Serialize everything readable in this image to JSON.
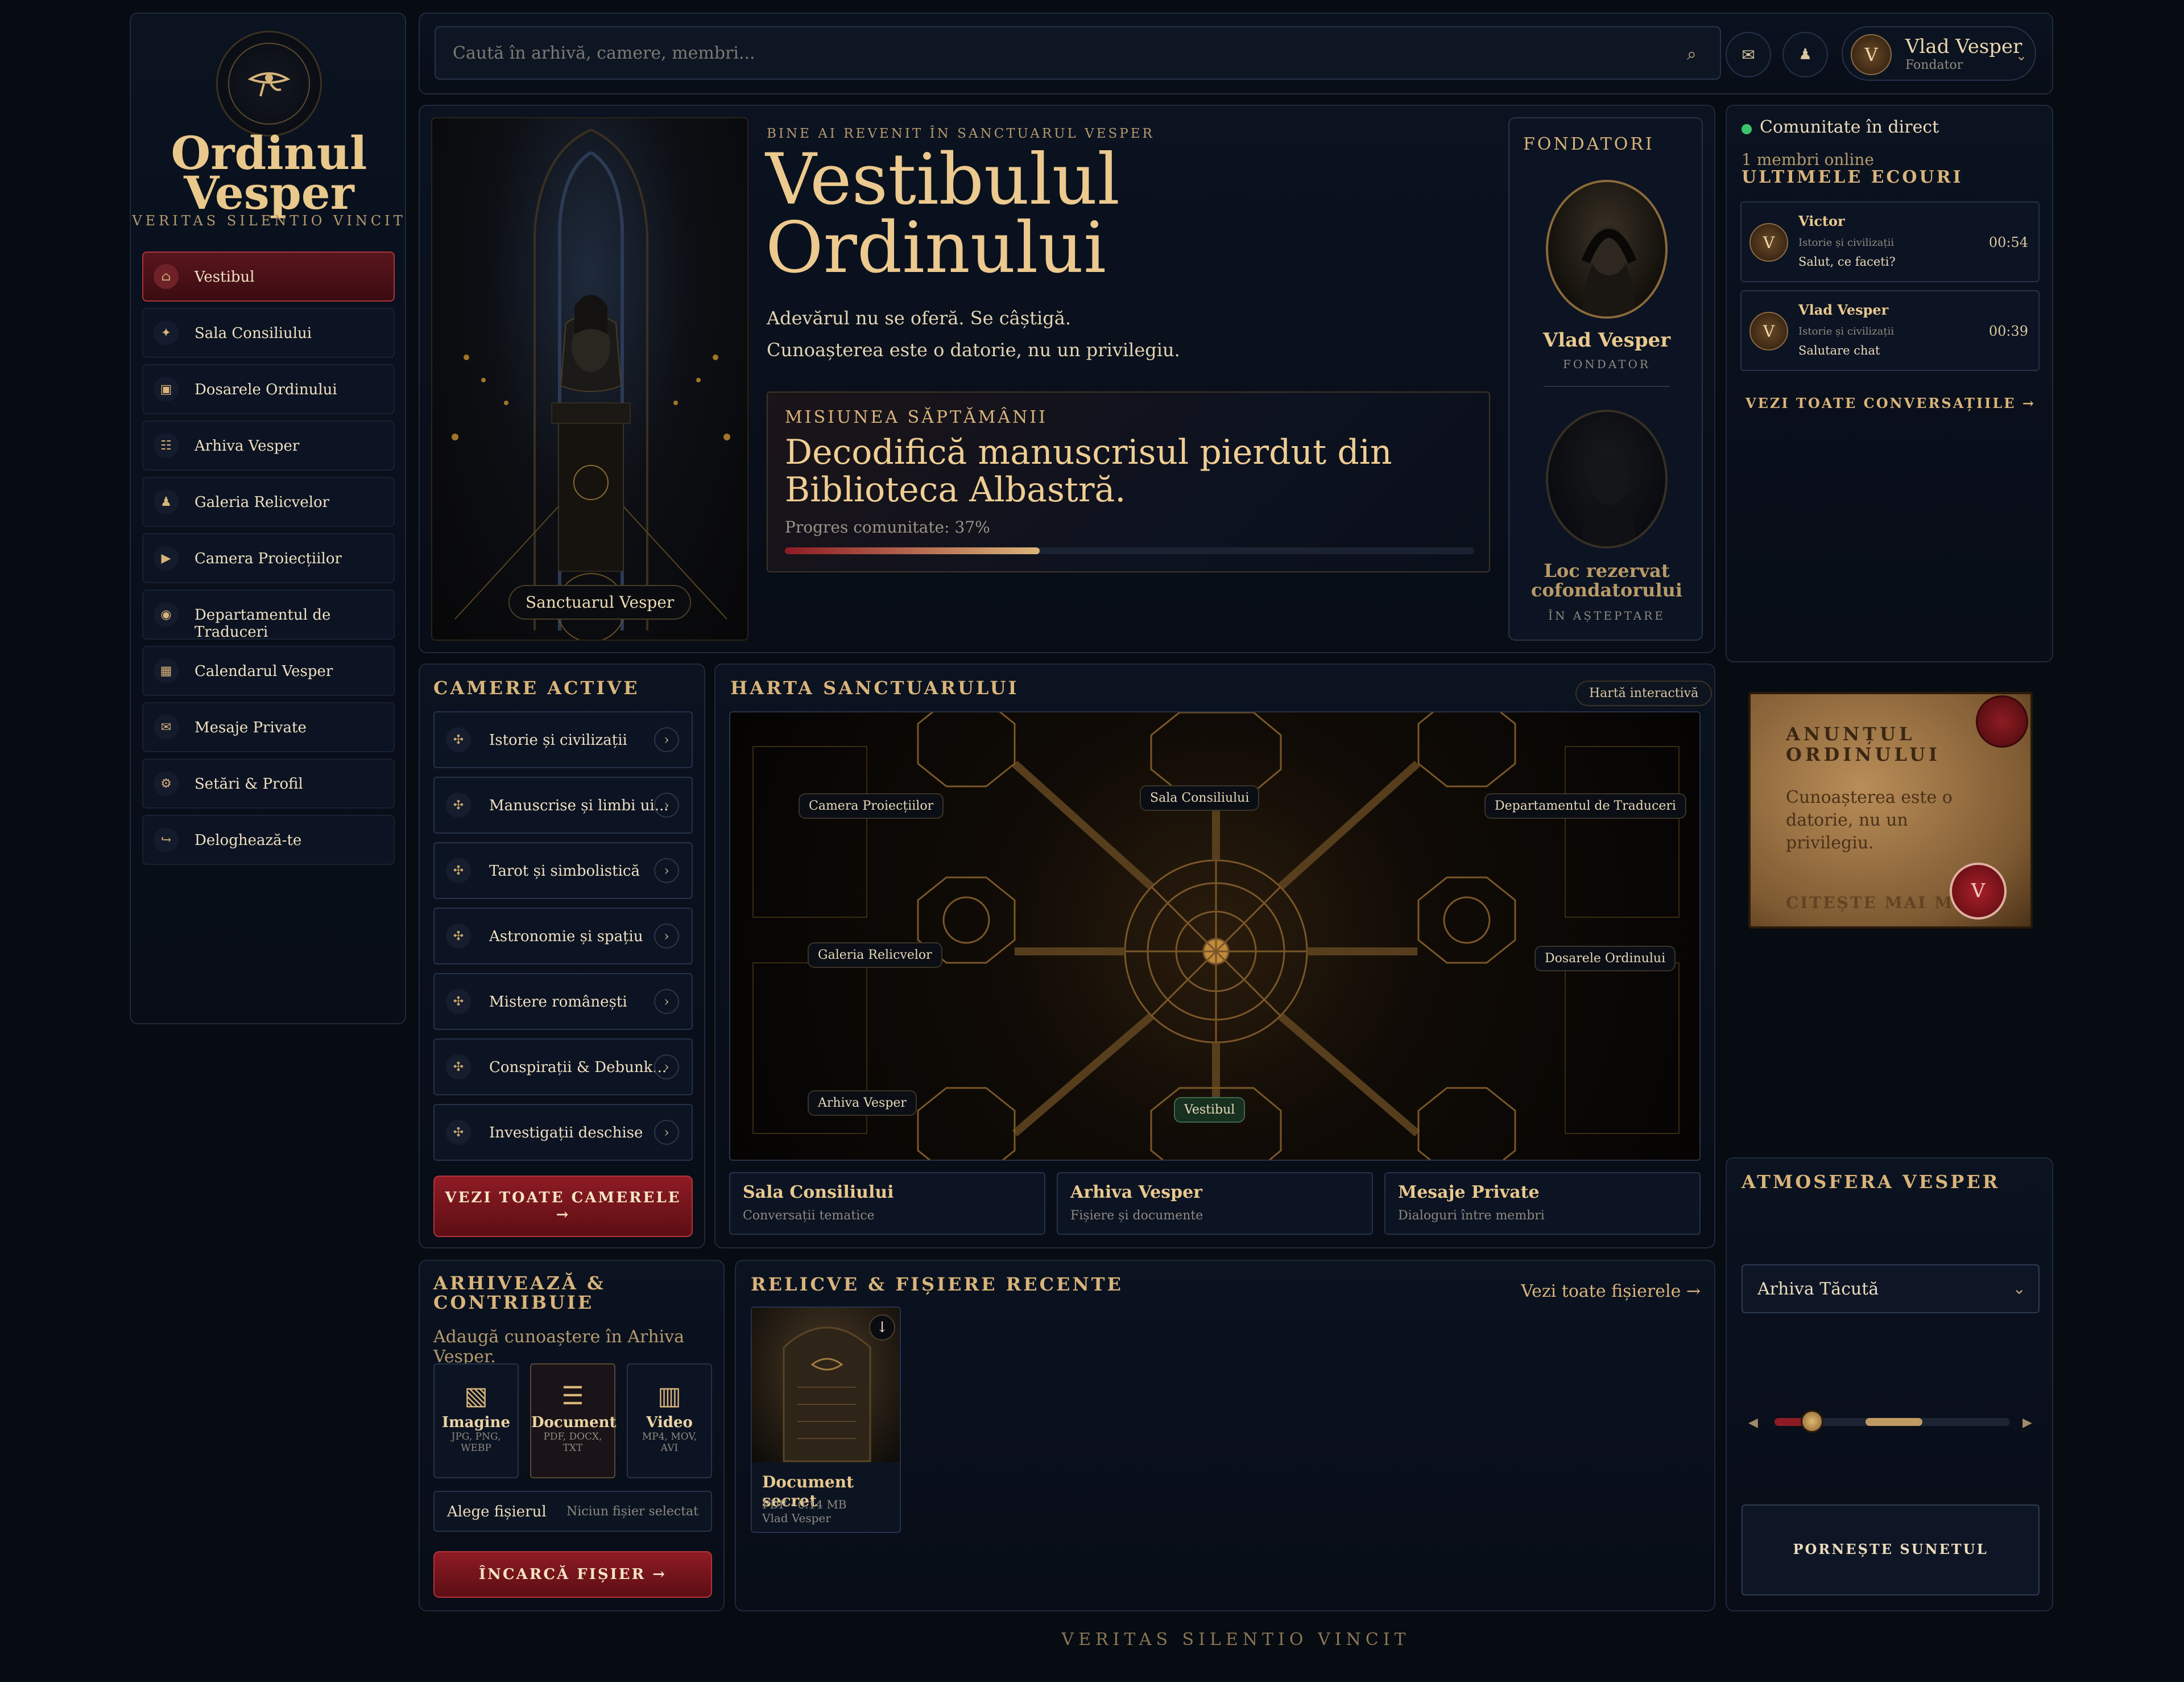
{
  "brand": {
    "name_line1": "Ordinul",
    "name_line2": "Vesper",
    "motto": "VERITAS SILENTIO VINCIT",
    "logo_icon": "eye-of-horus-icon"
  },
  "sidebar": {
    "items": [
      {
        "label": "Vestibul",
        "icon": "home-icon",
        "active": true
      },
      {
        "label": "Sala Consiliului",
        "icon": "compass-icon"
      },
      {
        "label": "Dosarele Ordinului",
        "icon": "folder-icon"
      },
      {
        "label": "Arhiva Vesper",
        "icon": "list-icon"
      },
      {
        "label": "Galeria Relicvelor",
        "icon": "figure-icon"
      },
      {
        "label": "Camera Proiecțiilor",
        "icon": "play-icon"
      },
      {
        "label": "Departamentul de Traduceri",
        "icon": "target-icon"
      },
      {
        "label": "Calendarul Vesper",
        "icon": "calendar-icon"
      },
      {
        "label": "Mesaje Private",
        "icon": "mail-icon"
      },
      {
        "label": "Setări & Profil",
        "icon": "gear-icon"
      },
      {
        "label": "Deloghează-te",
        "icon": "logout-icon"
      }
    ]
  },
  "header": {
    "search_placeholder": "Caută în arhivă, camere, membri...",
    "user_name": "Vlad Vesper",
    "user_role": "Fondator",
    "avatar_letter": "V"
  },
  "hero": {
    "eyebrow": "BINE AI REVENIT ÎN SANCTUARUL VESPER",
    "title_line1": "Vestibulul",
    "title_line2": "Ordinului",
    "line1": "Adevărul nu se oferă. Se câștigă.",
    "line2": "Cunoașterea este o datorie, nu un privilegiu.",
    "image_caption": "Sanctuarul Vesper"
  },
  "mission": {
    "label": "MISIUNEA SĂPTĂMÂNII",
    "title_line1": "Decodifică manuscrisul pierdut din",
    "title_line2": "Biblioteca Albastră.",
    "progress_text": "Progres comunitate: 37%",
    "progress": 0.37
  },
  "founders": {
    "title": "FONDATORI",
    "f1_name": "Vlad Vesper",
    "f1_role": "FONDATOR",
    "f2_name_line1": "Loc rezervat",
    "f2_name_line2": "cofondatorului",
    "f2_role": "ÎN AȘTEPTARE"
  },
  "community": {
    "live": "Comunitate în direct",
    "online": "1 membri online",
    "echo_title": "ULTIMELE ECOURI",
    "messages": [
      {
        "user": "Victor",
        "room": "Istorie și civilizații",
        "text": "Salut, ce faceti?",
        "time": "00:54",
        "letter": "V"
      },
      {
        "user": "Vlad Vesper",
        "room": "Istorie și civilizații",
        "text": "Salutare chat",
        "time": "00:39",
        "letter": "V"
      }
    ],
    "view_all": "VEZI TOATE CONVERSAȚIILE →"
  },
  "rooms": {
    "title": "CAMERE ACTIVE",
    "items": [
      "Istorie și civilizații",
      "Manuscrise și limbi ui...",
      "Tarot și simbolistică",
      "Astronomie și spațiu",
      "Mistere românești",
      "Conspirații & Debunk...",
      "Investigații deschise"
    ],
    "button_line1": "VEZI TOATE CAMERELE",
    "button_line2": "→"
  },
  "map": {
    "title": "HARTA SANCTUARULUI",
    "badge": "Hartă interactivă",
    "labels": {
      "proiectii": "Camera Proiecțiilor",
      "consiliu": "Sala Consiliului",
      "traduceri": "Departamentul de Traduceri",
      "relicve": "Galeria Relicvelor",
      "dosare": "Dosarele Ordinului",
      "arhiva": "Arhiva Vesper",
      "vestibul": "Vestibul"
    },
    "cards": [
      {
        "title": "Sala Consiliului",
        "sub": "Conversații tematice"
      },
      {
        "title": "Arhiva Vesper",
        "sub": "Fișiere și documente"
      },
      {
        "title": "Mesaje Private",
        "sub": "Dialoguri între membri"
      }
    ]
  },
  "announcement": {
    "title_line1": "ANUNȚUL",
    "title_line2": "ORDINULUI",
    "text_line1": "Cunoașterea este o",
    "text_line2": "datorie, nu un",
    "text_line3": "privilegiu.",
    "read_more": "CITEȘTE MAI MULT",
    "seal_letter": "V"
  },
  "archive": {
    "title_line1": "ARHIVEAZĂ &",
    "title_line2": "CONTRIBUIE",
    "subtitle": "Adaugă cunoaștere în Arhiva Vesper.",
    "types": [
      {
        "label": "Imagine",
        "line1": "JPG, PNG,",
        "line2": "WEBP",
        "icon": "image-icon"
      },
      {
        "label": "Document",
        "line1": "PDF, DOCX,",
        "line2": "TXT",
        "icon": "document-icon"
      },
      {
        "label": "Video",
        "line1": "MP4, MOV,",
        "line2": "AVI",
        "icon": "video-icon"
      }
    ],
    "choose": "Alege fișierul",
    "no_file": "Niciun fișier selectat",
    "upload": "ÎNCARCĂ FIȘIER →"
  },
  "relics": {
    "title": "RELICVE & FIȘIERE RECENTE",
    "view_all": "Vezi toate fișierele →",
    "file": {
      "name": "Document secret",
      "meta": "PDF · 0.14 MB",
      "owner": "Vlad Vesper"
    }
  },
  "atmosphere": {
    "title": "ATMOSFERA VESPER",
    "track": "Arhiva Tăcută",
    "volume": 0.16,
    "start": "PORNEȘTE SUNETUL"
  },
  "footer": {
    "motto": "VERITAS SILENTIO VINCIT"
  },
  "colors": {
    "gold": "#d9b47a",
    "crimson": "#8e1b24",
    "online": "#3cc46a",
    "bg": "#070b12"
  }
}
